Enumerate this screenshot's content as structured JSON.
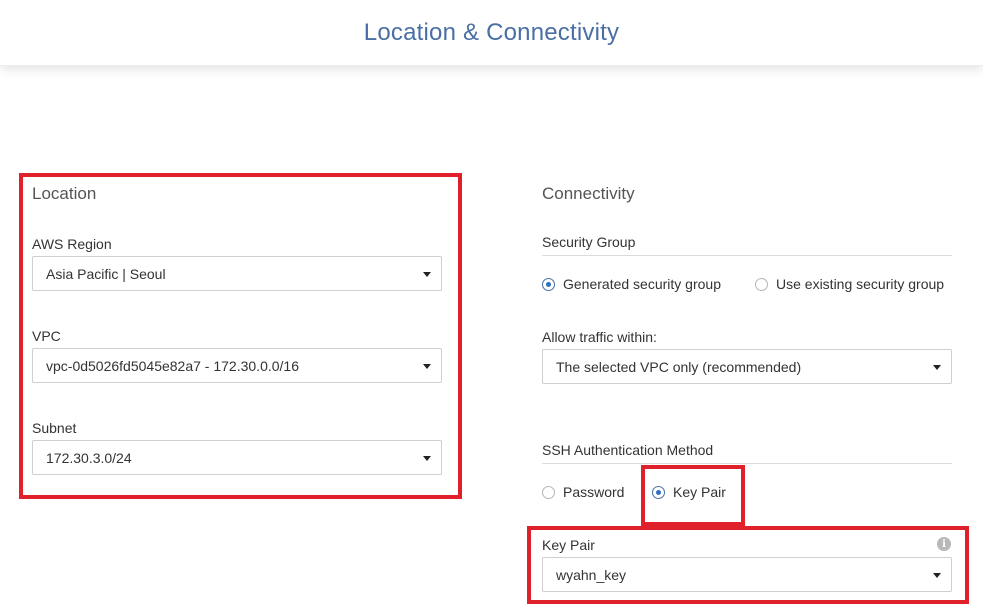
{
  "header": {
    "title": "Location & Connectivity"
  },
  "location": {
    "title": "Location",
    "aws_region": {
      "label": "AWS Region",
      "value": "Asia Pacific | Seoul"
    },
    "vpc": {
      "label": "VPC",
      "value": "vpc-0d5026fd5045e82a7 - 172.30.0.0/16"
    },
    "subnet": {
      "label": "Subnet",
      "value": "172.30.3.0/24"
    }
  },
  "connectivity": {
    "title": "Connectivity",
    "security_group": {
      "label": "Security Group",
      "options": [
        {
          "label": "Generated security group",
          "selected": true
        },
        {
          "label": "Use existing security group",
          "selected": false
        }
      ]
    },
    "allow_traffic": {
      "label": "Allow traffic within:",
      "value": "The selected VPC only (recommended)"
    },
    "ssh_auth": {
      "label": "SSH Authentication Method",
      "options": [
        {
          "label": "Password",
          "selected": false
        },
        {
          "label": "Key Pair",
          "selected": true
        }
      ]
    },
    "key_pair": {
      "label": "Key Pair",
      "value": "wyahn_key",
      "info_icon": "info-icon"
    }
  },
  "colors": {
    "title_blue": "#4a6fa5",
    "radio_blue": "#2f6fbf",
    "highlight_red": "#e0202b"
  }
}
